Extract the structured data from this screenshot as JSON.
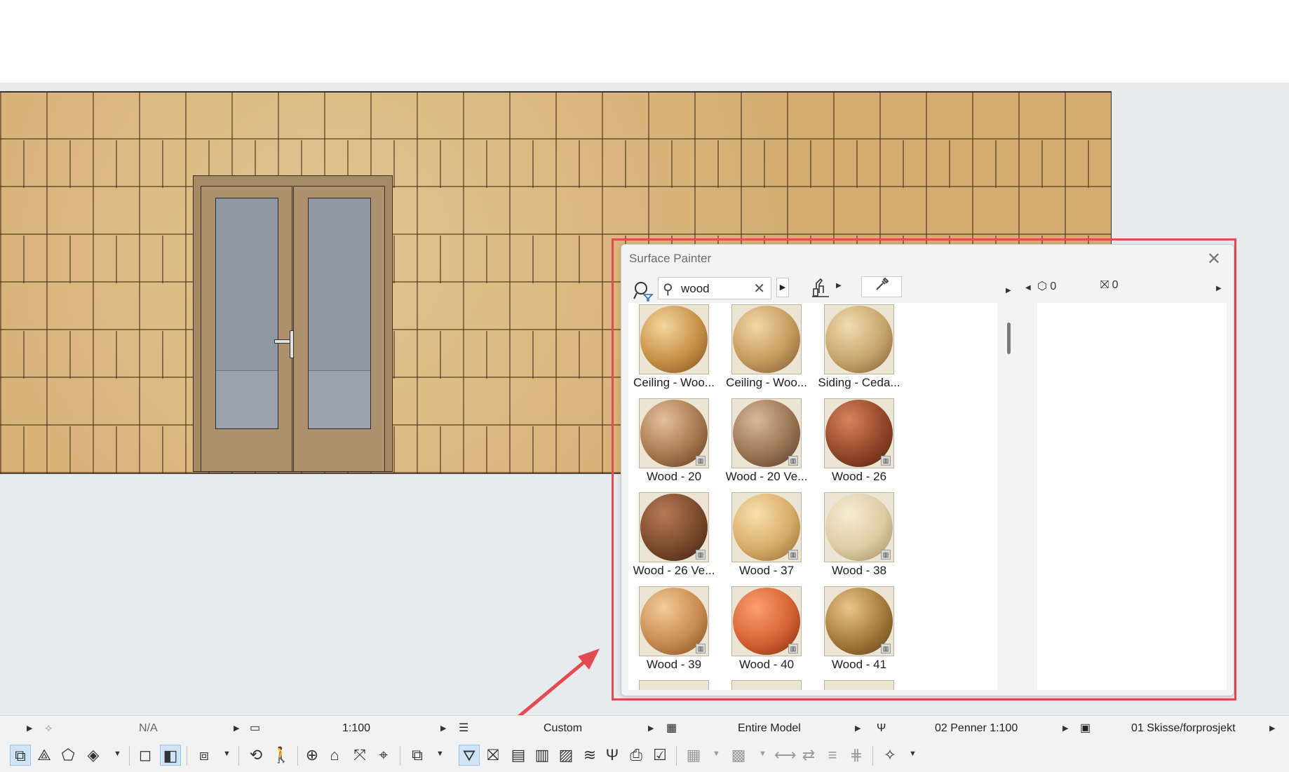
{
  "dialog": {
    "title": "Surface Painter",
    "search": {
      "value": "wood",
      "placeholder": ""
    },
    "materials": [
      {
        "label": "Ceiling - Woo...",
        "colors": [
          "#f3d7a0",
          "#c79046",
          "#7a4f22"
        ],
        "library": false
      },
      {
        "label": "Ceiling - Woo...",
        "colors": [
          "#f2d8a8",
          "#c59a5d",
          "#7b5630"
        ],
        "library": false
      },
      {
        "label": "Siding - Ceda...",
        "colors": [
          "#efdcb1",
          "#c7a56c",
          "#7a5a32"
        ],
        "library": false
      },
      {
        "label": "Wood - 20",
        "colors": [
          "#e3c19c",
          "#a8784e",
          "#5a3a20"
        ],
        "library": true
      },
      {
        "label": "Wood - 20 Ve...",
        "colors": [
          "#d9b89a",
          "#9a7455",
          "#55392a"
        ],
        "library": true
      },
      {
        "label": "Wood - 26",
        "colors": [
          "#d7845a",
          "#93462a",
          "#4f2110"
        ],
        "library": true
      },
      {
        "label": "Wood - 26 Ve...",
        "colors": [
          "#b67a55",
          "#7a4a2c",
          "#3b2010"
        ],
        "library": true
      },
      {
        "label": "Wood - 37",
        "colors": [
          "#f8e0ad",
          "#d8ac68",
          "#8d6430"
        ],
        "library": true
      },
      {
        "label": "Wood - 38",
        "colors": [
          "#f6ecd4",
          "#ddcca4",
          "#9a875a"
        ],
        "library": true
      },
      {
        "label": "Wood - 39",
        "colors": [
          "#f4cb98",
          "#c98b52",
          "#7a4a22"
        ],
        "library": true
      },
      {
        "label": "Wood - 40",
        "colors": [
          "#fb9f6f",
          "#d56334",
          "#7a2a0e"
        ],
        "library": true
      },
      {
        "label": "Wood - 41",
        "colors": [
          "#e8c68c",
          "#a57a3a",
          "#5a3e18"
        ],
        "library": true
      }
    ],
    "right_counts": {
      "elements": "0",
      "surfaces": "0"
    }
  },
  "status_bar": {
    "layer_combo": "N/A",
    "scale": "1:100",
    "structure": "Custom",
    "model_view": "Entire Model",
    "pen_set": "02 Penner 1:100",
    "renovation": "01 Skisse/forprosjekt"
  },
  "colors": {
    "highlight": "#e34b52",
    "wall_base": "#d3ad72"
  }
}
